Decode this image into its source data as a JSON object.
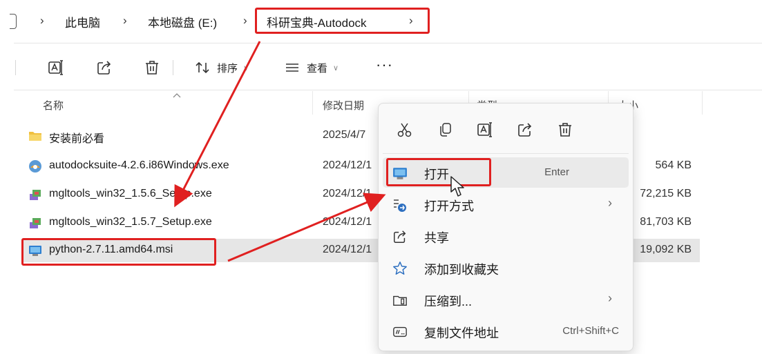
{
  "breadcrumb": {
    "items": [
      "此电脑",
      "本地磁盘 (E:)",
      "科研宝典-Autodock"
    ],
    "separator": "›"
  },
  "toolbar": {
    "sort_label": "排序",
    "view_label": "查看",
    "more_label": "···",
    "icons": [
      "rename-icon",
      "share-icon",
      "delete-icon",
      "sort-icon",
      "view-icon",
      "more-icon"
    ]
  },
  "columns": {
    "name": "名称",
    "date": "修改日期",
    "type": "类型",
    "size": "大小"
  },
  "files": [
    {
      "name": "安装前必看",
      "date": "2025/4/7",
      "size": "",
      "icon": "folder-icon"
    },
    {
      "name": "autodocksuite-4.2.6.i86Windows.exe",
      "date": "2024/12/1",
      "size": "564 KB",
      "icon": "installer-icon"
    },
    {
      "name": "mgltools_win32_1.5.6_Setup.exe",
      "date": "2024/12/1",
      "size": "72,215 KB",
      "icon": "setup-icon"
    },
    {
      "name": "mgltools_win32_1.5.7_Setup.exe",
      "date": "2024/12/1",
      "size": "81,703 KB",
      "icon": "setup-icon"
    },
    {
      "name": "python-2.7.11.amd64.msi",
      "date": "2024/12/1",
      "size": "19,092 KB",
      "icon": "msi-icon"
    }
  ],
  "context_menu": {
    "quick_actions": [
      "cut-icon",
      "copy-icon",
      "rename-icon",
      "share-icon",
      "delete-icon"
    ],
    "items": [
      {
        "label": "打开",
        "shortcut": "Enter",
        "icon": "msi-icon"
      },
      {
        "label": "打开方式",
        "submenu": "›",
        "icon": "open-with-icon"
      },
      {
        "label": "共享",
        "icon": "share-icon"
      },
      {
        "label": "添加到收藏夹",
        "icon": "star-icon"
      },
      {
        "label": "压缩到...",
        "submenu": "›",
        "icon": "archive-icon"
      },
      {
        "label": "复制文件地址",
        "shortcut": "Ctrl+Shift+C",
        "icon": "copy-path-icon"
      }
    ]
  },
  "colors": {
    "highlight_red": "#e02020",
    "selected_row": "#e6e6e6",
    "folder_yellow": "#f0c040"
  }
}
